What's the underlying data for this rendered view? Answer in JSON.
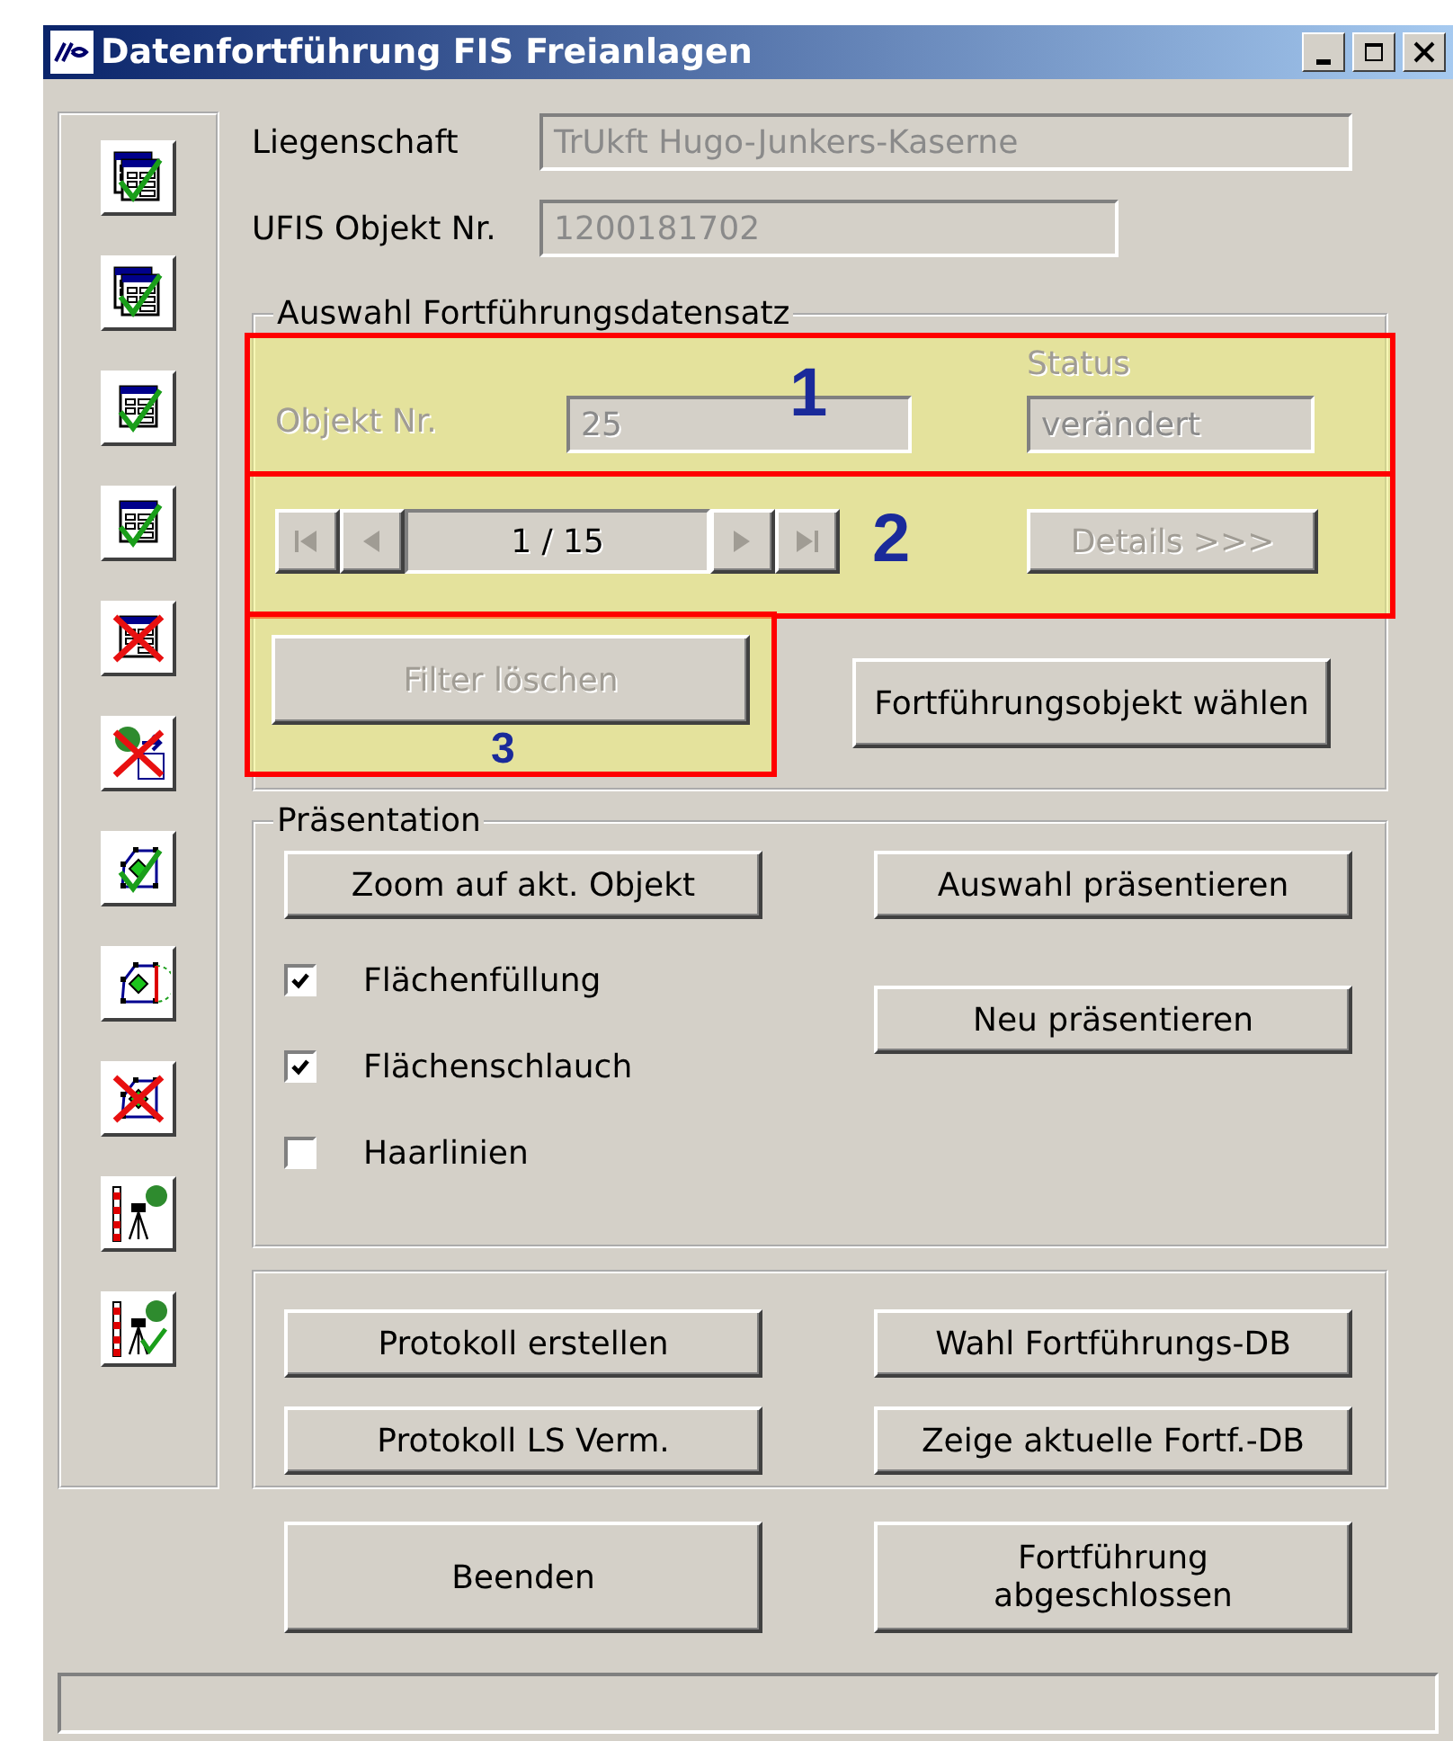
{
  "window": {
    "title": "Datenfortführung FIS Freianlagen"
  },
  "toolbar": [
    {
      "kind": "doc-check-double"
    },
    {
      "kind": "doc-check-double"
    },
    {
      "kind": "doc-check"
    },
    {
      "kind": "doc-check"
    },
    {
      "kind": "doc-cross"
    },
    {
      "kind": "tree-cross"
    },
    {
      "kind": "polygon-check"
    },
    {
      "kind": "polygon-arc"
    },
    {
      "kind": "polygon-cross"
    },
    {
      "kind": "survey"
    },
    {
      "kind": "survey-check"
    }
  ],
  "liegenschaft": {
    "label": "Liegenschaft",
    "value": "TrUkft Hugo-Junkers-Kaserne"
  },
  "ufis": {
    "label": "UFIS Objekt Nr.",
    "value": "1200181702"
  },
  "auswahl": {
    "title": "Auswahl Fortführungsdatensatz",
    "objekt": {
      "annotation": "1",
      "label": "Objekt Nr.",
      "value": "25",
      "status_label": "Status",
      "status_value": "verändert",
      "disabled": true
    },
    "nav": {
      "annotation": "2",
      "counter": "1 / 15",
      "details": "Details >>>",
      "disabled": true
    },
    "filter": {
      "annotation": "3",
      "label": "Filter löschen",
      "disabled": true
    },
    "choose": {
      "label": "Fortführungsobjekt wählen"
    }
  },
  "praesentation": {
    "title": "Präsentation",
    "zoom": "Zoom auf akt. Objekt",
    "auswahl": "Auswahl präsentieren",
    "neu": "Neu präsentieren",
    "checks": [
      {
        "label": "Flächenfüllung",
        "checked": true
      },
      {
        "label": "Flächenschlauch",
        "checked": true
      },
      {
        "label": "Haarlinien",
        "checked": false
      }
    ]
  },
  "protokoll": [
    "Protokoll erstellen",
    "Wahl Fortführungs-DB",
    "Protokoll LS Verm.",
    "Zeige aktuelle Fortf.-DB"
  ],
  "bottom": [
    "Beenden",
    "Fortführung\nabgeschlossen"
  ]
}
